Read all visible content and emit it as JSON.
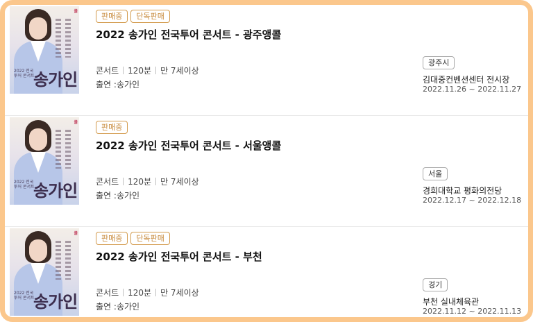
{
  "concerts": [
    {
      "badges": [
        "판매중",
        "단독판매"
      ],
      "title": "2022 송가인 전국투어 콘서트 - 광주앵콜",
      "genre": "콘서트",
      "duration": "120분",
      "age": "만 7세이상",
      "cast": "출연 :송가인",
      "region": "광주시",
      "venue": "김대중컨벤션센터 전시장",
      "dates": "2022.11.26 ~ 2022.11.27"
    },
    {
      "badges": [
        "판매중"
      ],
      "title": "2022 송가인 전국투어 콘서트 - 서울앵콜",
      "genre": "콘서트",
      "duration": "120분",
      "age": "만 7세이상",
      "cast": "출연 :송가인",
      "region": "서울",
      "venue": "경희대학교 평화의전당",
      "dates": "2022.12.17 ~ 2022.12.18"
    },
    {
      "badges": [
        "판매중",
        "단독판매"
      ],
      "title": "2022 송가인 전국투어 콘서트 - 부천",
      "genre": "콘서트",
      "duration": "120분",
      "age": "만 7세이상",
      "cast": "출연 :송가인",
      "region": "경기",
      "venue": "부천 실내체육관",
      "dates": "2022.11.12 ~ 2022.11.13"
    }
  ],
  "poster": {
    "art_title": "송가인",
    "art_subtitle": "2022 전국투어 콘서트",
    "art_mark": "쿨",
    "colors": {
      "badge_border": "#d39a4c",
      "badge_text": "#c7893a",
      "frame": "#fbc78c"
    }
  }
}
